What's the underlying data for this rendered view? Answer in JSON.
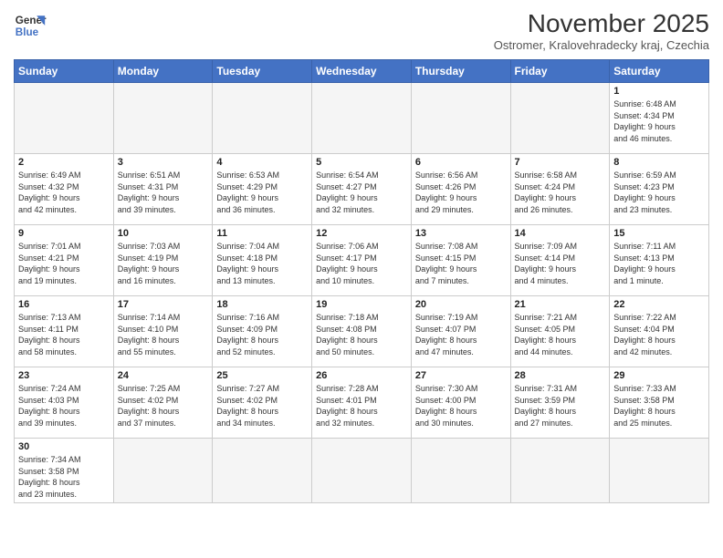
{
  "logo": {
    "line1": "General",
    "line2": "Blue"
  },
  "title": "November 2025",
  "subtitle": "Ostromer, Kralovehradecky kraj, Czechia",
  "header_days": [
    "Sunday",
    "Monday",
    "Tuesday",
    "Wednesday",
    "Thursday",
    "Friday",
    "Saturday"
  ],
  "weeks": [
    [
      {
        "day": "",
        "info": ""
      },
      {
        "day": "",
        "info": ""
      },
      {
        "day": "",
        "info": ""
      },
      {
        "day": "",
        "info": ""
      },
      {
        "day": "",
        "info": ""
      },
      {
        "day": "",
        "info": ""
      },
      {
        "day": "1",
        "info": "Sunrise: 6:48 AM\nSunset: 4:34 PM\nDaylight: 9 hours\nand 46 minutes."
      }
    ],
    [
      {
        "day": "2",
        "info": "Sunrise: 6:49 AM\nSunset: 4:32 PM\nDaylight: 9 hours\nand 42 minutes."
      },
      {
        "day": "3",
        "info": "Sunrise: 6:51 AM\nSunset: 4:31 PM\nDaylight: 9 hours\nand 39 minutes."
      },
      {
        "day": "4",
        "info": "Sunrise: 6:53 AM\nSunset: 4:29 PM\nDaylight: 9 hours\nand 36 minutes."
      },
      {
        "day": "5",
        "info": "Sunrise: 6:54 AM\nSunset: 4:27 PM\nDaylight: 9 hours\nand 32 minutes."
      },
      {
        "day": "6",
        "info": "Sunrise: 6:56 AM\nSunset: 4:26 PM\nDaylight: 9 hours\nand 29 minutes."
      },
      {
        "day": "7",
        "info": "Sunrise: 6:58 AM\nSunset: 4:24 PM\nDaylight: 9 hours\nand 26 minutes."
      },
      {
        "day": "8",
        "info": "Sunrise: 6:59 AM\nSunset: 4:23 PM\nDaylight: 9 hours\nand 23 minutes."
      }
    ],
    [
      {
        "day": "9",
        "info": "Sunrise: 7:01 AM\nSunset: 4:21 PM\nDaylight: 9 hours\nand 19 minutes."
      },
      {
        "day": "10",
        "info": "Sunrise: 7:03 AM\nSunset: 4:19 PM\nDaylight: 9 hours\nand 16 minutes."
      },
      {
        "day": "11",
        "info": "Sunrise: 7:04 AM\nSunset: 4:18 PM\nDaylight: 9 hours\nand 13 minutes."
      },
      {
        "day": "12",
        "info": "Sunrise: 7:06 AM\nSunset: 4:17 PM\nDaylight: 9 hours\nand 10 minutes."
      },
      {
        "day": "13",
        "info": "Sunrise: 7:08 AM\nSunset: 4:15 PM\nDaylight: 9 hours\nand 7 minutes."
      },
      {
        "day": "14",
        "info": "Sunrise: 7:09 AM\nSunset: 4:14 PM\nDaylight: 9 hours\nand 4 minutes."
      },
      {
        "day": "15",
        "info": "Sunrise: 7:11 AM\nSunset: 4:13 PM\nDaylight: 9 hours\nand 1 minute."
      }
    ],
    [
      {
        "day": "16",
        "info": "Sunrise: 7:13 AM\nSunset: 4:11 PM\nDaylight: 8 hours\nand 58 minutes."
      },
      {
        "day": "17",
        "info": "Sunrise: 7:14 AM\nSunset: 4:10 PM\nDaylight: 8 hours\nand 55 minutes."
      },
      {
        "day": "18",
        "info": "Sunrise: 7:16 AM\nSunset: 4:09 PM\nDaylight: 8 hours\nand 52 minutes."
      },
      {
        "day": "19",
        "info": "Sunrise: 7:18 AM\nSunset: 4:08 PM\nDaylight: 8 hours\nand 50 minutes."
      },
      {
        "day": "20",
        "info": "Sunrise: 7:19 AM\nSunset: 4:07 PM\nDaylight: 8 hours\nand 47 minutes."
      },
      {
        "day": "21",
        "info": "Sunrise: 7:21 AM\nSunset: 4:05 PM\nDaylight: 8 hours\nand 44 minutes."
      },
      {
        "day": "22",
        "info": "Sunrise: 7:22 AM\nSunset: 4:04 PM\nDaylight: 8 hours\nand 42 minutes."
      }
    ],
    [
      {
        "day": "23",
        "info": "Sunrise: 7:24 AM\nSunset: 4:03 PM\nDaylight: 8 hours\nand 39 minutes."
      },
      {
        "day": "24",
        "info": "Sunrise: 7:25 AM\nSunset: 4:02 PM\nDaylight: 8 hours\nand 37 minutes."
      },
      {
        "day": "25",
        "info": "Sunrise: 7:27 AM\nSunset: 4:02 PM\nDaylight: 8 hours\nand 34 minutes."
      },
      {
        "day": "26",
        "info": "Sunrise: 7:28 AM\nSunset: 4:01 PM\nDaylight: 8 hours\nand 32 minutes."
      },
      {
        "day": "27",
        "info": "Sunrise: 7:30 AM\nSunset: 4:00 PM\nDaylight: 8 hours\nand 30 minutes."
      },
      {
        "day": "28",
        "info": "Sunrise: 7:31 AM\nSunset: 3:59 PM\nDaylight: 8 hours\nand 27 minutes."
      },
      {
        "day": "29",
        "info": "Sunrise: 7:33 AM\nSunset: 3:58 PM\nDaylight: 8 hours\nand 25 minutes."
      }
    ],
    [
      {
        "day": "30",
        "info": "Sunrise: 7:34 AM\nSunset: 3:58 PM\nDaylight: 8 hours\nand 23 minutes."
      },
      {
        "day": "",
        "info": ""
      },
      {
        "day": "",
        "info": ""
      },
      {
        "day": "",
        "info": ""
      },
      {
        "day": "",
        "info": ""
      },
      {
        "day": "",
        "info": ""
      },
      {
        "day": "",
        "info": ""
      }
    ]
  ]
}
